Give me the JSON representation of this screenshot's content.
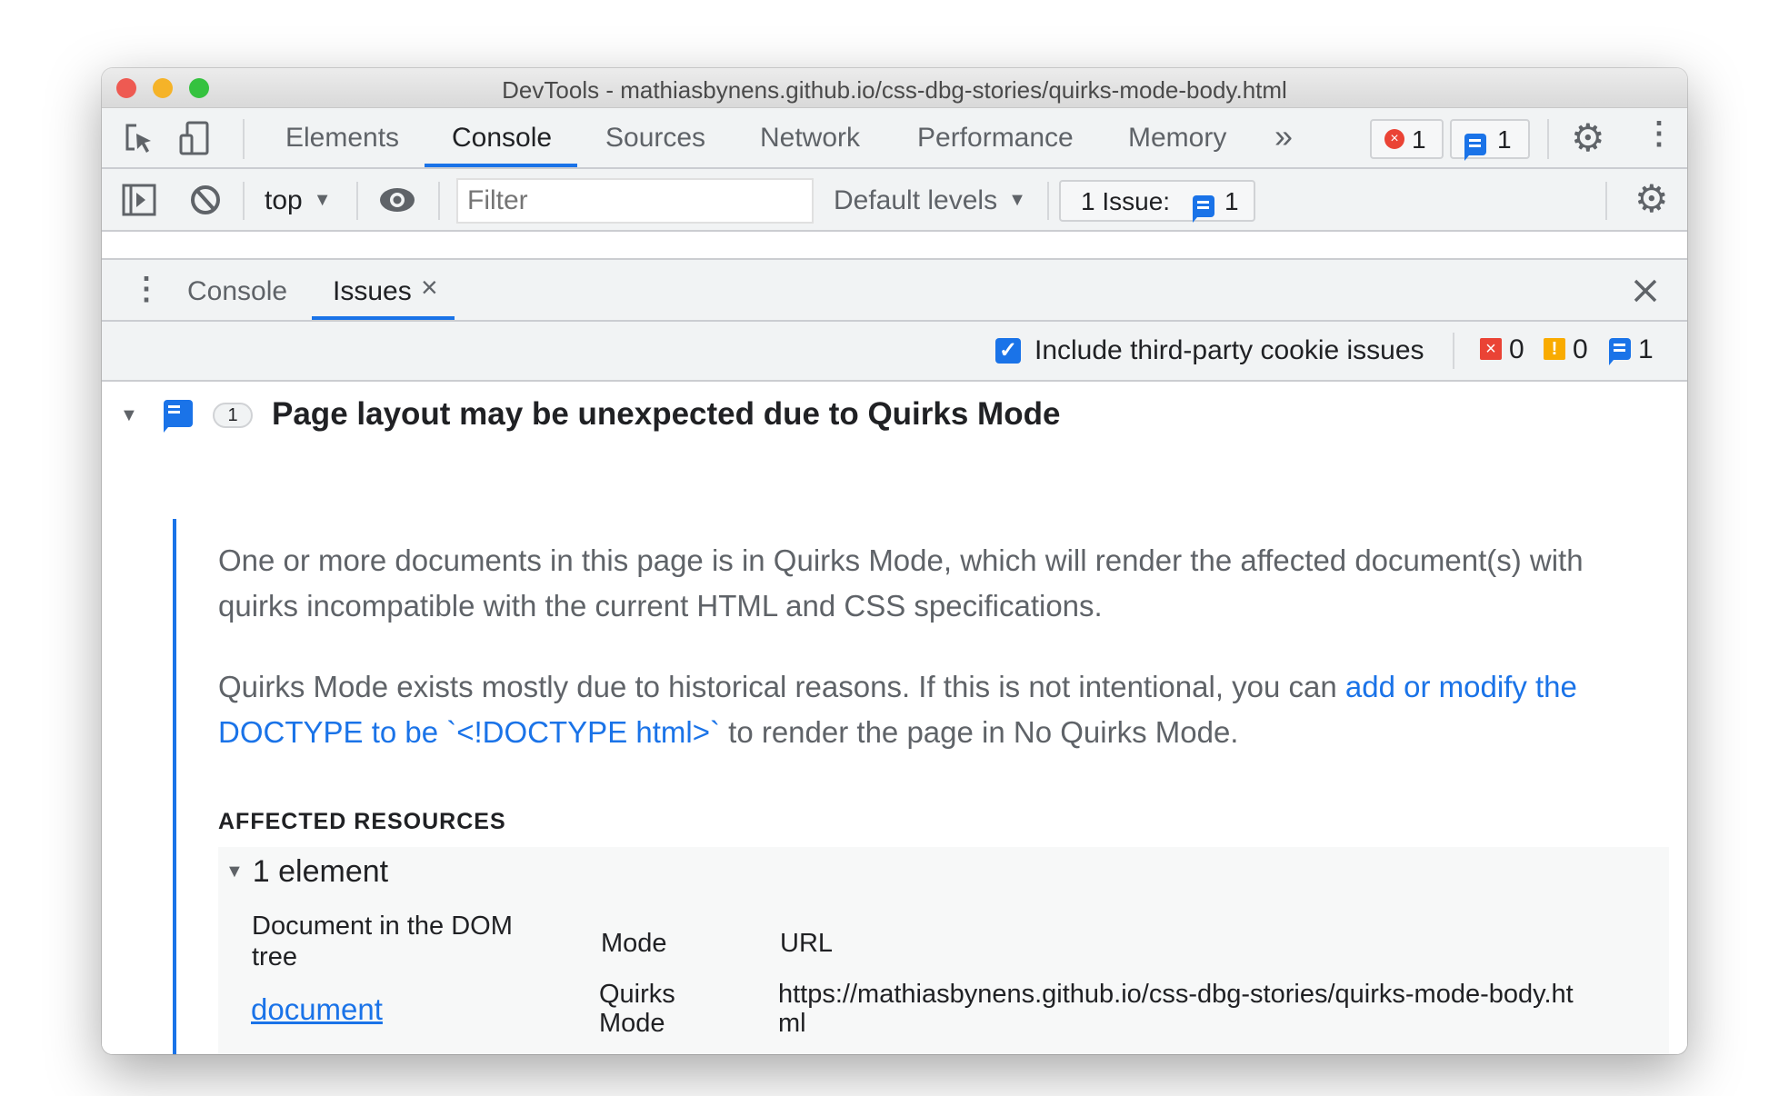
{
  "window": {
    "title": "DevTools - mathiasbynens.github.io/css-dbg-stories/quirks-mode-body.html"
  },
  "main_tabs": [
    {
      "label": "Elements"
    },
    {
      "label": "Console",
      "active": true
    },
    {
      "label": "Sources"
    },
    {
      "label": "Network"
    },
    {
      "label": "Performance"
    },
    {
      "label": "Memory"
    }
  ],
  "more_tabs": "»",
  "status": {
    "errors": "1",
    "issues": "1"
  },
  "console_toolbar": {
    "context": "top",
    "filter_placeholder": "Filter",
    "levels": "Default levels",
    "issue_label": "1 Issue:",
    "issue_count": "1"
  },
  "drawer": {
    "tabs": [
      {
        "label": "Console"
      },
      {
        "label": "Issues",
        "active": true
      }
    ],
    "close_tab": "×"
  },
  "issues_toolbar": {
    "checkbox_label": "Include third-party cookie issues",
    "checked": true,
    "counts": {
      "errors": "0",
      "warnings": "0",
      "info": "1"
    }
  },
  "issue": {
    "count": "1",
    "title": "Page layout may be unexpected due to Quirks Mode",
    "description": "One or more documents in this page is in Quirks Mode, which will render the affected document(s) with quirks incompatible with the current HTML and CSS specifications.",
    "para2_text": "Quirks Mode exists mostly due to historical reasons. If this is not intentional, you can ",
    "para2_link": "add or modify the DOCTYPE to be `<!DOCTYPE html>`",
    "para2_tail": " to render the page in No Quirks Mode.",
    "affected_heading": "AFFECTED RESOURCES",
    "resource_group": "1 element",
    "columns": [
      "Document in the DOM tree",
      "Mode",
      "URL"
    ],
    "rows": [
      {
        "document": "document",
        "mode": "Quirks Mode",
        "url": "https://mathiasbynens.github.io/css-dbg-stories/quirks-mode-body.html"
      }
    ]
  },
  "colors": {
    "accent": "#1a73e8",
    "error": "#ea4335",
    "warning": "#f9ab00"
  }
}
